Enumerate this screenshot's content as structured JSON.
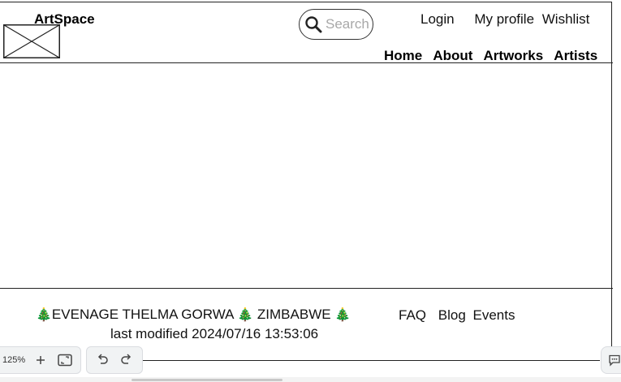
{
  "header": {
    "brand": "ArtSpace",
    "search": {
      "placeholder": "Search",
      "value": ""
    },
    "top_links": {
      "login": "Login",
      "profile": "My profile",
      "wishlist": "Wishlist"
    },
    "nav": [
      "Home",
      "About",
      "Artworks",
      "Artists"
    ]
  },
  "footer": {
    "name": "EVENAGE THELMA GORWA",
    "country": "ZIMBABWE",
    "tree_glyph": "🎄",
    "links": {
      "faq": "FAQ",
      "blog": "Blog",
      "events": "Events"
    },
    "modified": "last modified 2024/07/16 13:53:06"
  },
  "toolbar": {
    "zoom": "125%",
    "icons": [
      "plus-icon",
      "fit-screen-icon",
      "undo-icon",
      "redo-icon",
      "comment-icon"
    ]
  }
}
